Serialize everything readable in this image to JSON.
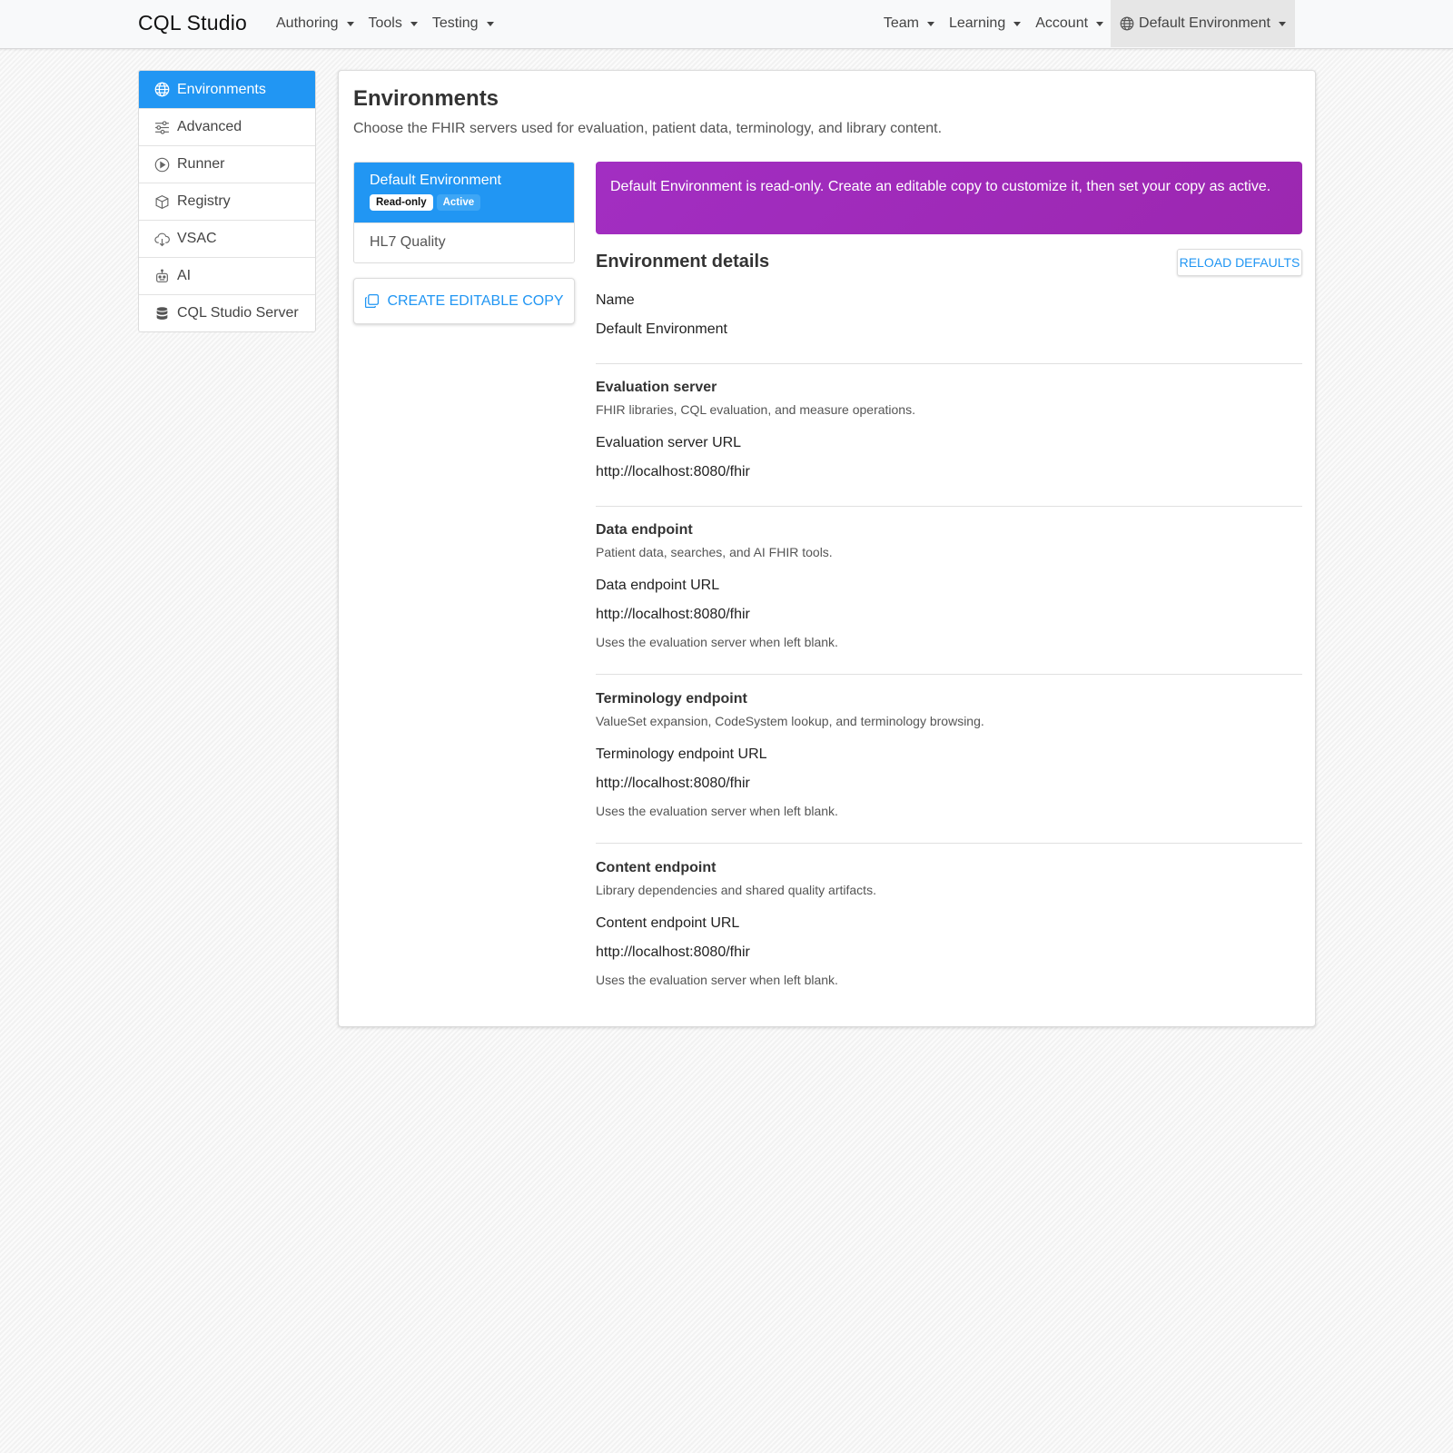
{
  "navbar": {
    "brand": "CQL Studio",
    "left_menus": [
      "Authoring",
      "Tools",
      "Testing"
    ],
    "right_menus": [
      "Team",
      "Learning",
      "Account"
    ],
    "environment_menu": "Default Environment"
  },
  "sidebar": {
    "items": [
      {
        "label": "Environments",
        "icon": "globe-icon",
        "active": true
      },
      {
        "label": "Advanced",
        "icon": "sliders-icon"
      },
      {
        "label": "Runner",
        "icon": "play-circle-icon"
      },
      {
        "label": "Registry",
        "icon": "box-icon"
      },
      {
        "label": "VSAC",
        "icon": "cloud-download-icon"
      },
      {
        "label": "AI",
        "icon": "robot-icon"
      },
      {
        "label": "CQL Studio Server",
        "icon": "database-icon"
      }
    ]
  },
  "main": {
    "title": "Environments",
    "subtitle": "Choose the FHIR servers used for evaluation, patient data, terminology, and library content.",
    "environments": [
      {
        "name": "Default Environment",
        "badges": [
          "Read-only",
          "Active"
        ]
      },
      {
        "name": "HL7 Quality"
      }
    ],
    "create_copy_label": "CREATE EDITABLE COPY",
    "alert": "Default Environment is read-only. Create an editable copy to customize it, then set your copy as active.",
    "details_title": "Environment details",
    "reload_label": "RELOAD DEFAULTS",
    "name_label": "Name",
    "name_value": "Default Environment",
    "sections": [
      {
        "title": "Evaluation server",
        "desc": "FHIR libraries, CQL evaluation, and measure operations.",
        "url_label": "Evaluation server URL",
        "url": "http://localhost:8080/fhir",
        "hint": ""
      },
      {
        "title": "Data endpoint",
        "desc": "Patient data, searches, and AI FHIR tools.",
        "url_label": "Data endpoint URL",
        "url": "http://localhost:8080/fhir",
        "hint": "Uses the evaluation server when left blank."
      },
      {
        "title": "Terminology endpoint",
        "desc": "ValueSet expansion, CodeSystem lookup, and terminology browsing.",
        "url_label": "Terminology endpoint URL",
        "url": "http://localhost:8080/fhir",
        "hint": "Uses the evaluation server when left blank."
      },
      {
        "title": "Content endpoint",
        "desc": "Library dependencies and shared quality artifacts.",
        "url_label": "Content endpoint URL",
        "url": "http://localhost:8080/fhir",
        "hint": "Uses the evaluation server when left blank."
      }
    ]
  },
  "colors": {
    "primary": "#2196f3",
    "alert": "#9c27b0"
  }
}
